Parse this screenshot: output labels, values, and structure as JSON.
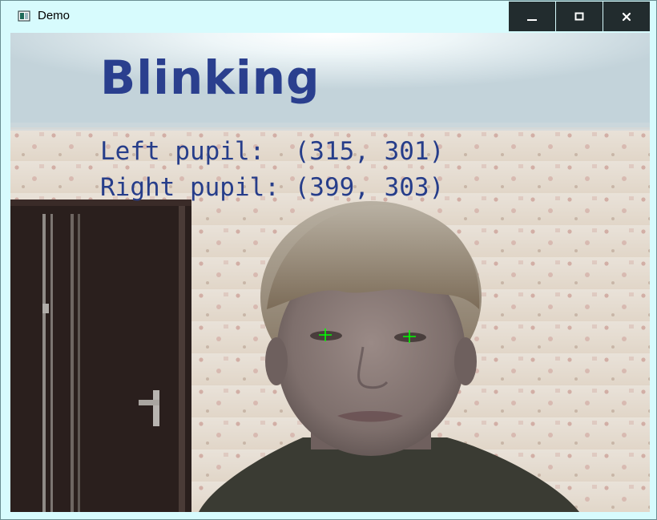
{
  "window": {
    "title": "Demo",
    "icon": "app-window-icon",
    "controls": {
      "minimize_icon": "minimize-icon",
      "maximize_icon": "maximize-icon",
      "close_icon": "close-icon"
    }
  },
  "overlay": {
    "status": "Blinking",
    "left_pupil": "Left pupil:  (315, 301)",
    "right_pupil": "Right pupil: (399, 303)",
    "text_color": "#263d8a",
    "marker_color": "#00ff00"
  },
  "scene": {
    "description_icon": "webcam-feed"
  }
}
